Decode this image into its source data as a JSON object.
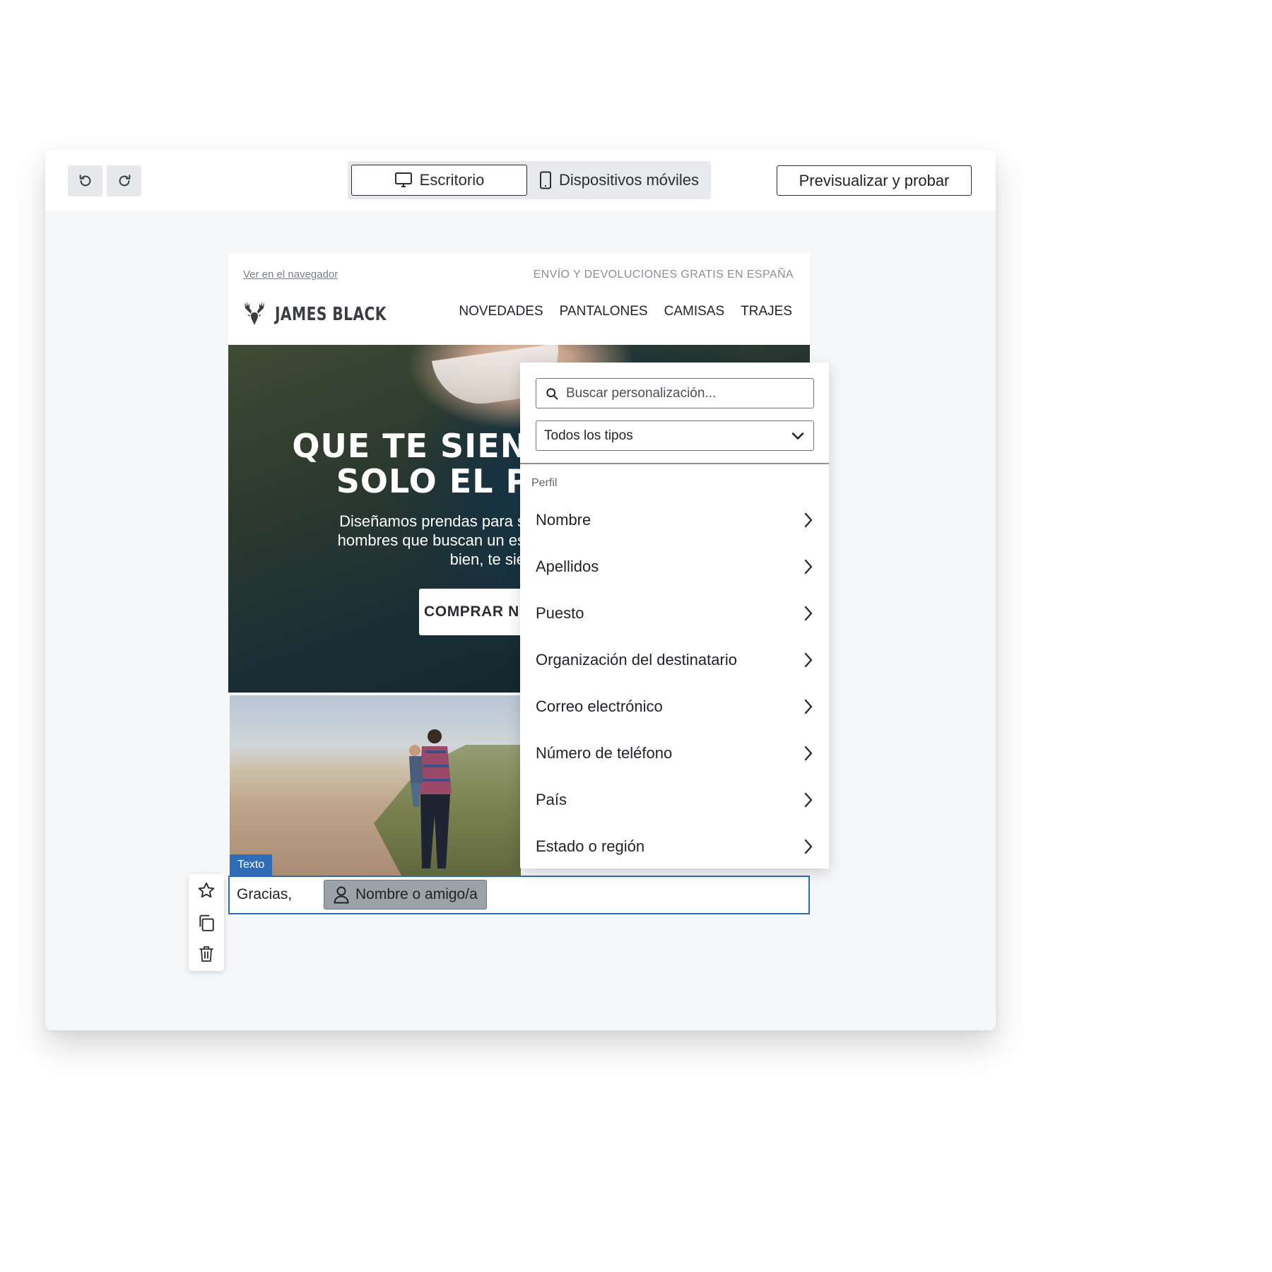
{
  "toolbar": {
    "undo_icon": "undo-icon",
    "redo_icon": "redo-icon",
    "device_toggle": {
      "desktop_label": "Escritorio",
      "mobile_label": "Dispositivos móviles",
      "selected": "Escritorio"
    },
    "preview_label": "Previsualizar y probar"
  },
  "email": {
    "view_in_browser": "Ver en el navegador",
    "shipping_banner": "ENVÍO Y DEVOLUCIONES GRATIS EN ESPAÑA",
    "brand_name": "JAMES BLACK",
    "nav": [
      "NOVEDADES",
      "PANTALONES",
      "CAMISAS",
      "TRAJES"
    ],
    "hero": {
      "title": "QUE TE SIENTA\nSOLO EL P",
      "subtitle": "Diseñamos prendas para s\nhombres que buscan un es\nbien, te sie",
      "cta": "COMPRAR N"
    },
    "selected_block": {
      "type_label": "Texto",
      "greeting": "Gracias,",
      "merge_tag": "Nombre o amigo/a"
    }
  },
  "block_actions": [
    "star-icon",
    "duplicate-icon",
    "delete-icon"
  ],
  "personalization_panel": {
    "search_placeholder": "Buscar personalización...",
    "type_filter": "Todos los tipos",
    "section": "Perfil",
    "fields": [
      "Nombre",
      "Apellidos",
      "Puesto",
      "Organización del destinatario",
      "Correo electrónico",
      "Número de teléfono",
      "País",
      "Estado o región"
    ]
  },
  "colors": {
    "accent": "#2e6cb8",
    "canvas_bg": "#f6f7f9",
    "toolbar_bg": "#ffffff",
    "merge_tag_bg": "#9ca2a8"
  }
}
